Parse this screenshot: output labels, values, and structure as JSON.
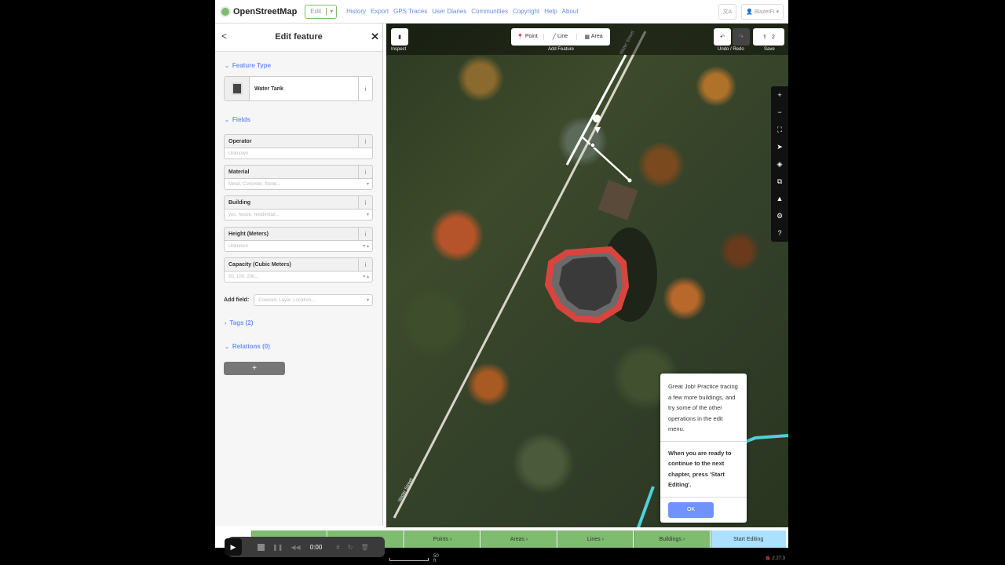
{
  "topnav": {
    "logo": "OpenStreetMap",
    "edit": "Edit",
    "links": [
      "History",
      "Export",
      "GPS Traces",
      "User Diaries",
      "Communities",
      "Copyright",
      "Help",
      "About"
    ],
    "user": "BlazerFi"
  },
  "sidebar": {
    "title": "Edit feature",
    "feature_type_label": "Feature Type",
    "feature_type": "Water Tank",
    "fields_label": "Fields",
    "fields": [
      {
        "label": "Operator",
        "placeholder": "Unknown",
        "dropdown": false,
        "stepper": false
      },
      {
        "label": "Material",
        "placeholder": "Metal, Concrete, Stone...",
        "dropdown": true,
        "stepper": false
      },
      {
        "label": "Building",
        "placeholder": "yes, house, residential...",
        "dropdown": true,
        "stepper": false
      },
      {
        "label": "Height (Meters)",
        "placeholder": "Unknown",
        "dropdown": false,
        "stepper": true
      },
      {
        "label": "Capacity (Cubic Meters)",
        "placeholder": "50, 100, 200...",
        "dropdown": false,
        "stepper": true
      }
    ],
    "add_field_label": "Add field:",
    "add_field_placeholder": "Covered, Layer, Location...",
    "tags_label": "Tags (2)",
    "relations_label": "Relations (0)",
    "add_relation": "+"
  },
  "map": {
    "toolbar": {
      "inspect_label": "Inspect",
      "point": "Point",
      "line": "Line",
      "area": "Area",
      "add_feature_label": "Add Feature",
      "undo_redo_label": "Undo / Redo",
      "save_count": "2",
      "save_label": "Save"
    },
    "street_label_1": "Water Street",
    "street_label_2": "Water Street"
  },
  "tooltip": {
    "text1": "Great Job! Practice tracing a few more buildings, and try some of the other operations in the edit menu.",
    "text2": "When you are ready to continue to the next chapter, press 'Start Editing'.",
    "ok": "OK"
  },
  "walkthrough": {
    "chapters": [
      "Points",
      "Areas",
      "Lines",
      "Buildings"
    ],
    "start": "Start Editing"
  },
  "scale": "50 ft",
  "version": "2.27.3",
  "recorder": {
    "time": "0:00"
  }
}
